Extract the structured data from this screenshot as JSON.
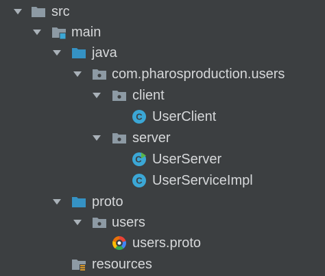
{
  "colors": {
    "background": "#3c3f41",
    "text": "#d6d8da",
    "chevron": "#a9b1b8",
    "folder_gray": "#8d9aa4",
    "folder_blue": "#3592c4",
    "class_badge": "#3ba7d6",
    "resources_badge": "#d99a2b"
  },
  "tree": {
    "src": {
      "label": "src",
      "icon": "folder-icon",
      "expanded": true
    },
    "main": {
      "label": "main",
      "icon": "source-root-folder-icon",
      "expanded": true
    },
    "java": {
      "label": "java",
      "icon": "source-folder-icon",
      "expanded": true
    },
    "package": {
      "label": "com.pharosproduction.users",
      "icon": "package-icon",
      "expanded": true
    },
    "client": {
      "label": "client",
      "icon": "package-icon",
      "expanded": true
    },
    "user_client": {
      "label": "UserClient",
      "icon": "java-class-icon"
    },
    "server": {
      "label": "server",
      "icon": "package-icon",
      "expanded": true
    },
    "user_server": {
      "label": "UserServer",
      "icon": "java-runnable-class-icon"
    },
    "user_service_impl": {
      "label": "UserServiceImpl",
      "icon": "java-class-icon"
    },
    "proto": {
      "label": "proto",
      "icon": "source-folder-icon",
      "expanded": true
    },
    "users": {
      "label": "users",
      "icon": "package-icon",
      "expanded": true
    },
    "users_proto": {
      "label": "users.proto",
      "icon": "protobuf-file-icon"
    },
    "resources": {
      "label": "resources",
      "icon": "resources-folder-icon"
    }
  }
}
